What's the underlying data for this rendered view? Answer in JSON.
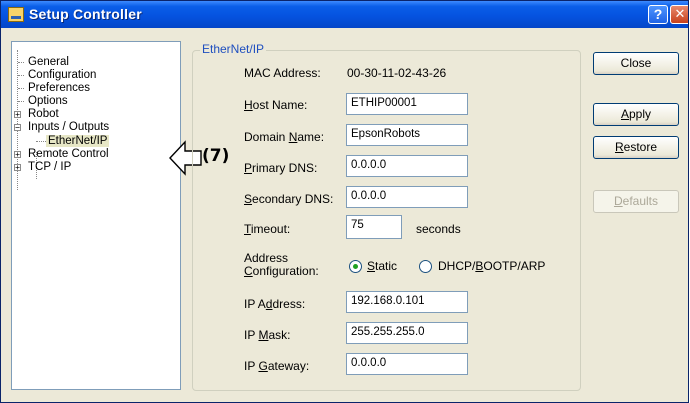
{
  "window": {
    "title": "Setup Controller"
  },
  "titlebar_buttons": {
    "help": "?",
    "close": "✕"
  },
  "tree": {
    "items": [
      {
        "label": "General"
      },
      {
        "label": "Configuration"
      },
      {
        "label": "Preferences"
      },
      {
        "label": "Options"
      },
      {
        "label": "Robot",
        "expander": "+"
      },
      {
        "label": "Inputs / Outputs",
        "expander": "−"
      },
      {
        "label": "EtherNet/IP",
        "selected": true
      },
      {
        "label": "Remote Control",
        "expander": "+"
      },
      {
        "label": "TCP / IP",
        "expander": "+"
      }
    ]
  },
  "callout": {
    "number": "(7)"
  },
  "group": {
    "title": "EtherNet/IP",
    "mac_label": "MAC Address:",
    "mac_value": "00-30-11-02-43-26",
    "host_label_u": "H",
    "host_label_rest": "ost Name:",
    "host_value": "ETHIP00001",
    "domain_label_a": "Domain ",
    "domain_label_u": "N",
    "domain_label_b": "ame:",
    "domain_value": "EpsonRobots",
    "pdns_label_u": "P",
    "pdns_label_rest": "rimary DNS:",
    "pdns_value": "0.0.0.0",
    "sdns_label_u": "S",
    "sdns_label_rest": "econdary DNS:",
    "sdns_value": "0.0.0.0",
    "timeout_label_u": "T",
    "timeout_label_rest": "imeout:",
    "timeout_value": "75",
    "timeout_unit": "seconds",
    "addr_cfg_line1": "Address",
    "addr_cfg_line2_u": "C",
    "addr_cfg_line2_rest": "onfiguration:",
    "radio_static_u": "S",
    "radio_static_rest": "tatic",
    "radio_dhcp_a": "DHCP/",
    "radio_dhcp_u": "B",
    "radio_dhcp_b": "OOTP/ARP",
    "static_selected": true,
    "ip_label_a": "IP A",
    "ip_label_u": "d",
    "ip_label_b": "dress:",
    "ip_value": "192.168.0.101",
    "mask_label_a": "IP ",
    "mask_label_u": "M",
    "mask_label_b": "ask:",
    "mask_value": "255.255.255.0",
    "gw_label_a": "IP ",
    "gw_label_u": "G",
    "gw_label_b": "ateway:",
    "gw_value": "0.0.0.0"
  },
  "buttons": {
    "close": "Close",
    "apply_u": "A",
    "apply_rest": "pply",
    "restore_u": "R",
    "restore_rest": "estore",
    "defaults_u": "D",
    "defaults_rest": "efaults"
  }
}
